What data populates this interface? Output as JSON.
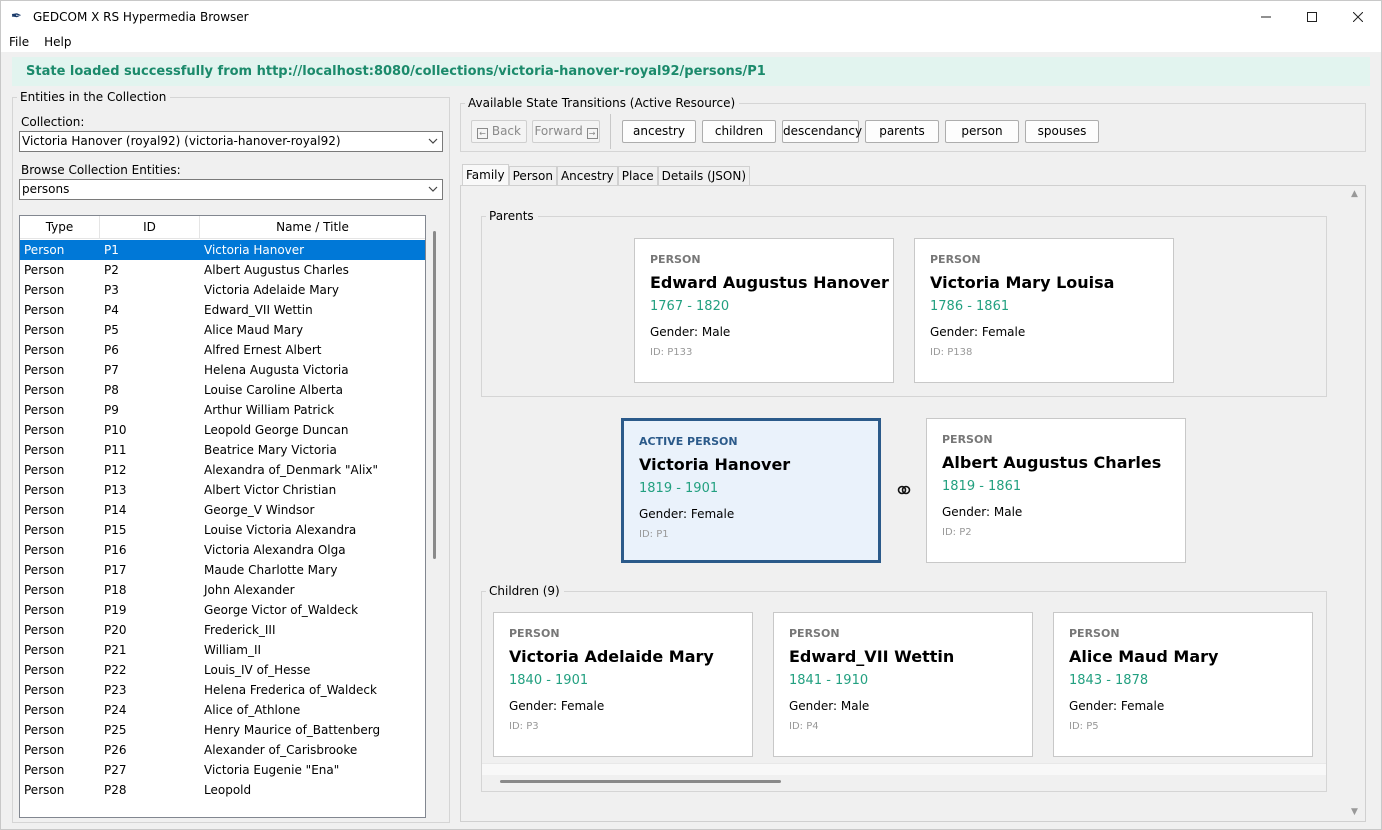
{
  "window": {
    "title": "GEDCOM X RS Hypermedia Browser",
    "app_icon": "quill-icon",
    "controls": {
      "minimize": "—",
      "maximize": "☐",
      "close": "✕"
    }
  },
  "menu": [
    "File",
    "Help"
  ],
  "status": "State loaded successfully from http://localhost:8080/collections/victoria-hanover-royal92/persons/P1",
  "left": {
    "group_title": "Entities in the Collection",
    "collection_label": "Collection:",
    "collection_value": "Victoria Hanover (royal92) (victoria-hanover-royal92)",
    "browse_label": "Browse Collection Entities:",
    "browse_value": "persons",
    "columns": [
      "Type",
      "ID",
      "Name / Title"
    ],
    "rows": [
      [
        "Person",
        "P1",
        "Victoria Hanover"
      ],
      [
        "Person",
        "P2",
        "Albert Augustus Charles"
      ],
      [
        "Person",
        "P3",
        "Victoria Adelaide Mary"
      ],
      [
        "Person",
        "P4",
        "Edward_VII Wettin"
      ],
      [
        "Person",
        "P5",
        "Alice Maud Mary"
      ],
      [
        "Person",
        "P6",
        "Alfred Ernest Albert"
      ],
      [
        "Person",
        "P7",
        "Helena Augusta Victoria"
      ],
      [
        "Person",
        "P8",
        "Louise Caroline Alberta"
      ],
      [
        "Person",
        "P9",
        "Arthur William Patrick"
      ],
      [
        "Person",
        "P10",
        "Leopold George Duncan"
      ],
      [
        "Person",
        "P11",
        "Beatrice Mary Victoria"
      ],
      [
        "Person",
        "P12",
        "Alexandra of_Denmark \"Alix\""
      ],
      [
        "Person",
        "P13",
        "Albert Victor Christian"
      ],
      [
        "Person",
        "P14",
        "George_V Windsor"
      ],
      [
        "Person",
        "P15",
        "Louise Victoria Alexandra"
      ],
      [
        "Person",
        "P16",
        "Victoria Alexandra Olga"
      ],
      [
        "Person",
        "P17",
        "Maude Charlotte Mary"
      ],
      [
        "Person",
        "P18",
        "John Alexander"
      ],
      [
        "Person",
        "P19",
        "George Victor of_Waldeck"
      ],
      [
        "Person",
        "P20",
        "Frederick_III"
      ],
      [
        "Person",
        "P21",
        "William_II"
      ],
      [
        "Person",
        "P22",
        "Louis_IV of_Hesse"
      ],
      [
        "Person",
        "P23",
        "Helena Frederica of_Waldeck"
      ],
      [
        "Person",
        "P24",
        "Alice of_Athlone"
      ],
      [
        "Person",
        "P25",
        "Henry Maurice of_Battenberg"
      ],
      [
        "Person",
        "P26",
        "Alexander of_Carisbrooke"
      ],
      [
        "Person",
        "P27",
        "Victoria Eugenie \"Ena\""
      ],
      [
        "Person",
        "P28",
        "Leopold"
      ]
    ],
    "selected_index": 0
  },
  "transitions": {
    "group_title": "Available State Transitions (Active Resource)",
    "back": "Back",
    "forward": "Forward",
    "links": [
      "ancestry",
      "children",
      "descendancy",
      "parents",
      "person",
      "spouses"
    ]
  },
  "tabs": [
    "Family",
    "Person",
    "Ancestry",
    "Place",
    "Details (JSON)"
  ],
  "active_tab": "Family",
  "family": {
    "parents_label": "Parents",
    "children_label": "Children (9)",
    "parents": [
      {
        "kind": "PERSON",
        "name": "Edward Augustus Hanover",
        "dates": "1767 - 1820",
        "gender": "Gender: Male",
        "id": "ID: P133"
      },
      {
        "kind": "PERSON",
        "name": "Victoria Mary Louisa",
        "dates": "1786 - 1861",
        "gender": "Gender: Female",
        "id": "ID: P138"
      }
    ],
    "active": {
      "kind": "ACTIVE PERSON",
      "name": "Victoria Hanover",
      "dates": "1819 - 1901",
      "gender": "Gender: Female",
      "id": "ID: P1"
    },
    "spouse_icon": "rings-icon",
    "spouse": {
      "kind": "PERSON",
      "name": "Albert Augustus Charles",
      "dates": "1819 - 1861",
      "gender": "Gender: Male",
      "id": "ID: P2"
    },
    "children": [
      {
        "kind": "PERSON",
        "name": "Victoria Adelaide Mary",
        "dates": "1840 - 1901",
        "gender": "Gender: Female",
        "id": "ID: P3"
      },
      {
        "kind": "PERSON",
        "name": "Edward_VII Wettin",
        "dates": "1841 - 1910",
        "gender": "Gender: Male",
        "id": "ID: P4"
      },
      {
        "kind": "PERSON",
        "name": "Alice Maud Mary",
        "dates": "1843 - 1878",
        "gender": "Gender: Female",
        "id": "ID: P5"
      }
    ]
  },
  "colors": {
    "status_bg": "#e2f4ef",
    "status_text": "#1b8a6b",
    "selection": "#0078d7",
    "dates": "#22a080",
    "active_border": "#2b5a8a"
  }
}
